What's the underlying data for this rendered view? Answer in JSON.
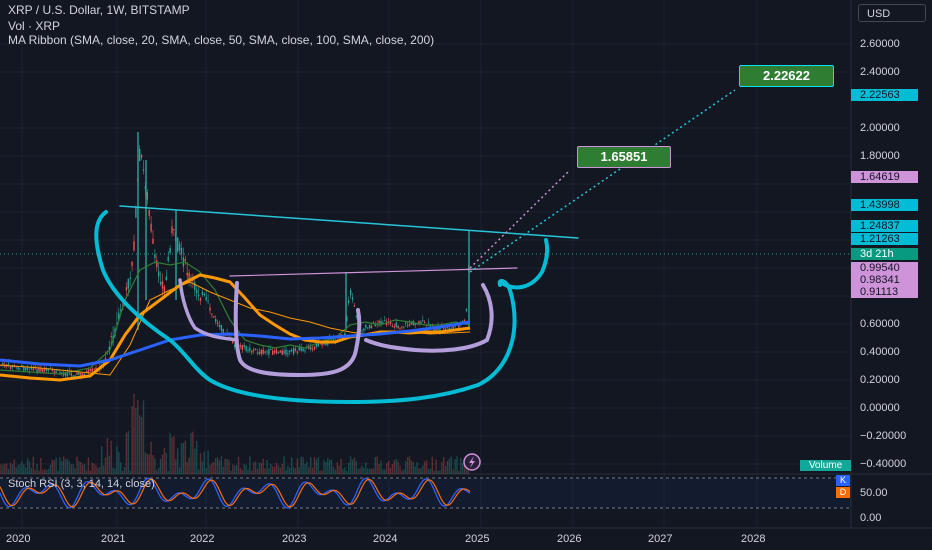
{
  "legend": {
    "symbol_line": "XRP / U.S. Dollar, 1W, BITSTAMP",
    "volume_line": "Vol · XRP",
    "ribbon_line": "MA Ribbon (SMA, close, 20, SMA, close, 50, SMA, close, 100, SMA, close, 200)"
  },
  "currency_button": "USD",
  "price_axis": [
    "2.60000",
    "2.40000",
    "2.00000",
    "1.80000",
    "0.60000",
    "0.40000",
    "0.20000",
    "0.00000",
    "−0.20000",
    "−0.40000"
  ],
  "price_tags": [
    {
      "text": "2.22563",
      "bg": "#00bcd4",
      "fg": "#131722"
    },
    {
      "text": "1.64619",
      "bg": "#ce93d8",
      "fg": "#131722"
    },
    {
      "text": "1.43998",
      "bg": "#00bcd4",
      "fg": "#131722"
    },
    {
      "text": "1.24837",
      "bg": "#00bcd4",
      "fg": "#131722"
    },
    {
      "text": "1.21263",
      "bg": "#00bcd4",
      "fg": "#131722"
    },
    {
      "text": "3d 21h",
      "bg": "#089981",
      "fg": "#ffffff"
    },
    {
      "text": "0.99540",
      "bg": "#ce93d8",
      "fg": "#131722"
    },
    {
      "text": "0.98341",
      "bg": "#ce93d8",
      "fg": "#131722"
    },
    {
      "text": "0.91113",
      "bg": "#ce93d8",
      "fg": "#131722"
    }
  ],
  "callouts": [
    {
      "text": "2.22622",
      "bg": "#2e7d32",
      "border": "#00e5ff"
    },
    {
      "text": "1.65851",
      "bg": "#2e7d32",
      "border": "#ce93d8"
    }
  ],
  "volume_label": "Volume",
  "stoch": {
    "label": "Stoch RSI (3, 3, 14, 14, close)",
    "k_label": "K",
    "d_label": "D",
    "axis": [
      "50.00",
      "0.00"
    ],
    "k_color": "#2962ff",
    "d_color": "#ff6d00"
  },
  "time_axis": [
    "2020",
    "2021",
    "2022",
    "2023",
    "2024",
    "2025",
    "2026",
    "2027",
    "2028"
  ],
  "colors": {
    "background": "#131722",
    "up_candle": "#26a69a",
    "down_candle": "#ef5350",
    "cup_annotation": "#00bcd4",
    "handle_annotation": "#b39ddb",
    "ma_fast": "#ff9800",
    "ma_slow": "#2962ff"
  },
  "alert_icon": "lightning-icon"
}
